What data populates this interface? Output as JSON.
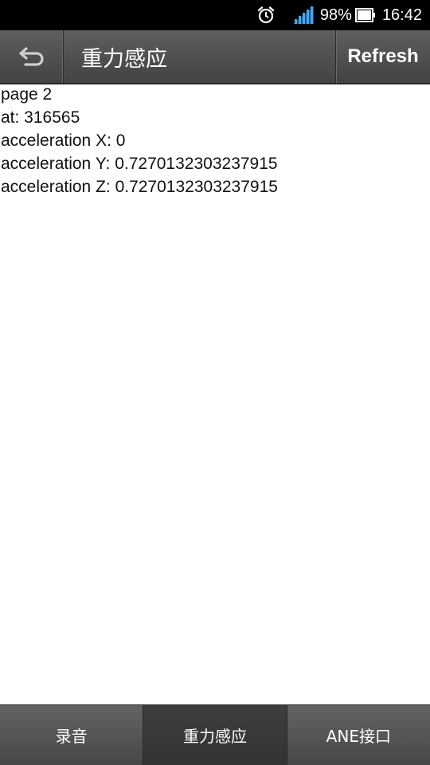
{
  "status_bar": {
    "battery_percent": "98%",
    "time": "16:42",
    "icons": [
      "alarm-icon",
      "signal-icon",
      "battery-icon"
    ]
  },
  "action_bar": {
    "back_icon": "back-arrow-icon",
    "title": "重力感应",
    "refresh_label": "Refresh"
  },
  "content": {
    "page": "page 2",
    "at": "at: 316565",
    "acc_x": "acceleration X: 0",
    "acc_y": "acceleration Y: 0.7270132303237915",
    "acc_z": "acceleration Z: 0.7270132303237915"
  },
  "bottom_tabs": [
    {
      "label": "录音"
    },
    {
      "label": "重力感应",
      "active": true
    },
    {
      "label": "ANE接口"
    }
  ]
}
